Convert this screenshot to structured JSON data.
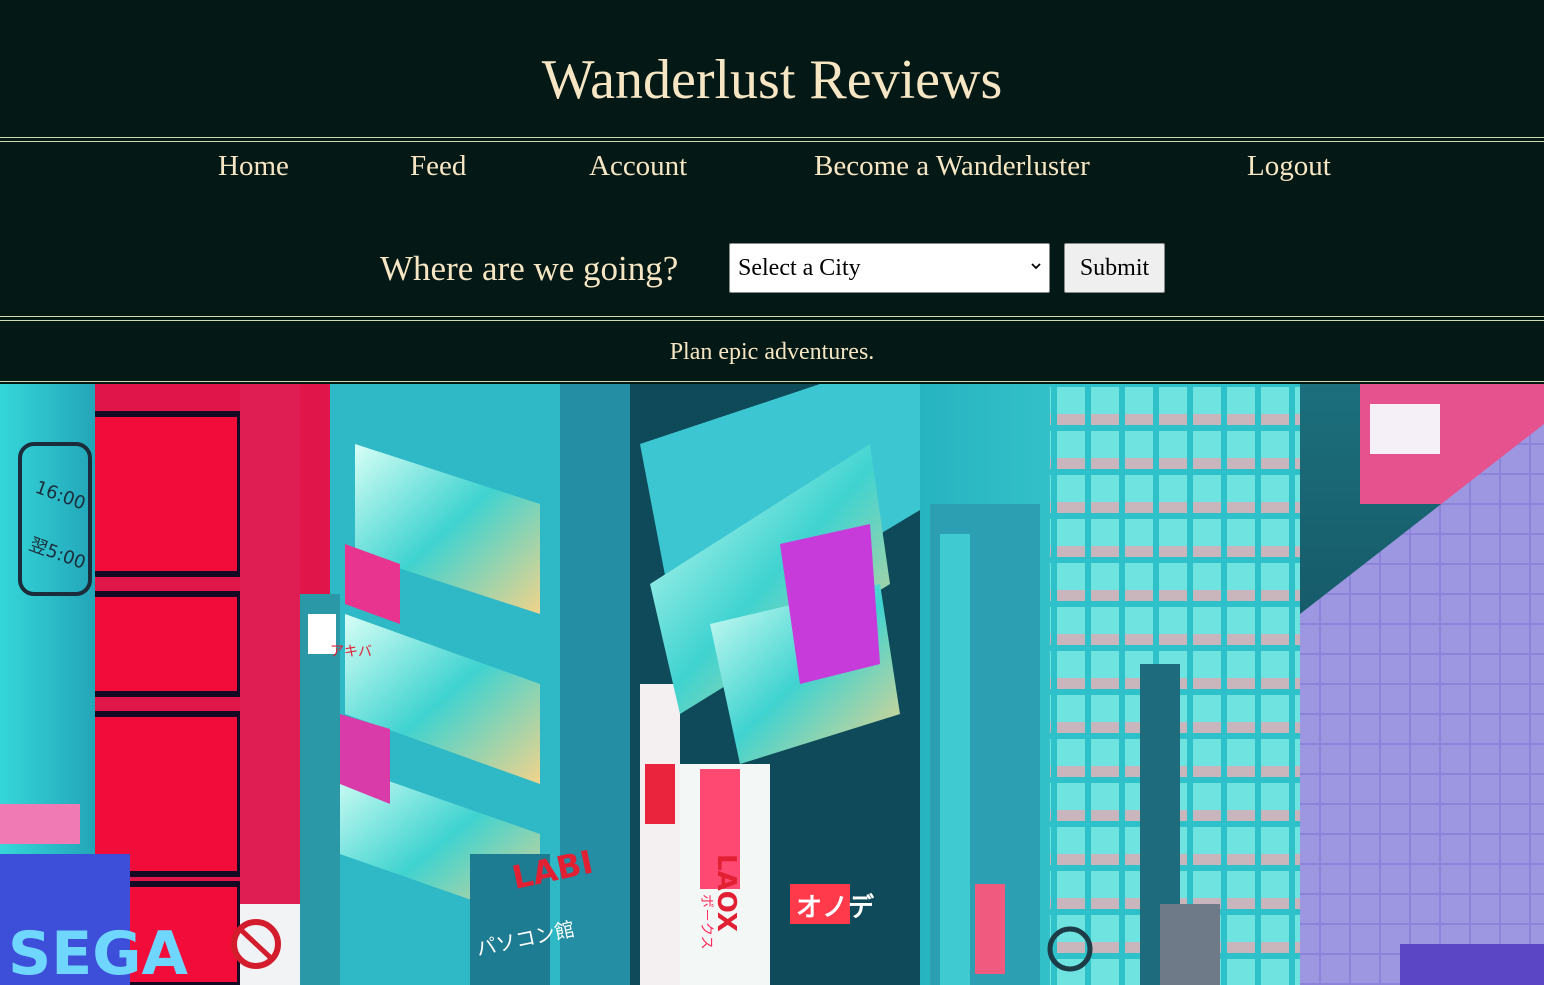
{
  "site": {
    "title": "Wanderlust Reviews",
    "tagline": "Plan epic adventures."
  },
  "nav": {
    "items": [
      {
        "label": "Home"
      },
      {
        "label": "Feed"
      },
      {
        "label": "Account"
      },
      {
        "label": "Become a Wanderluster"
      },
      {
        "label": "Logout"
      }
    ]
  },
  "search": {
    "prompt": "Where are we going?",
    "city_select_value": "Select a City",
    "submit_label": "Submit"
  },
  "hero": {
    "signs": [
      "SEGA",
      "LAOX",
      "オノデ",
      "LABI",
      "パソコン館",
      "アキバ",
      "16:00",
      "翌5:00",
      "ボ－クス"
    ]
  },
  "colors": {
    "background": "#041815",
    "text": "#f6e6c4",
    "rule": "#cfd8b0"
  }
}
